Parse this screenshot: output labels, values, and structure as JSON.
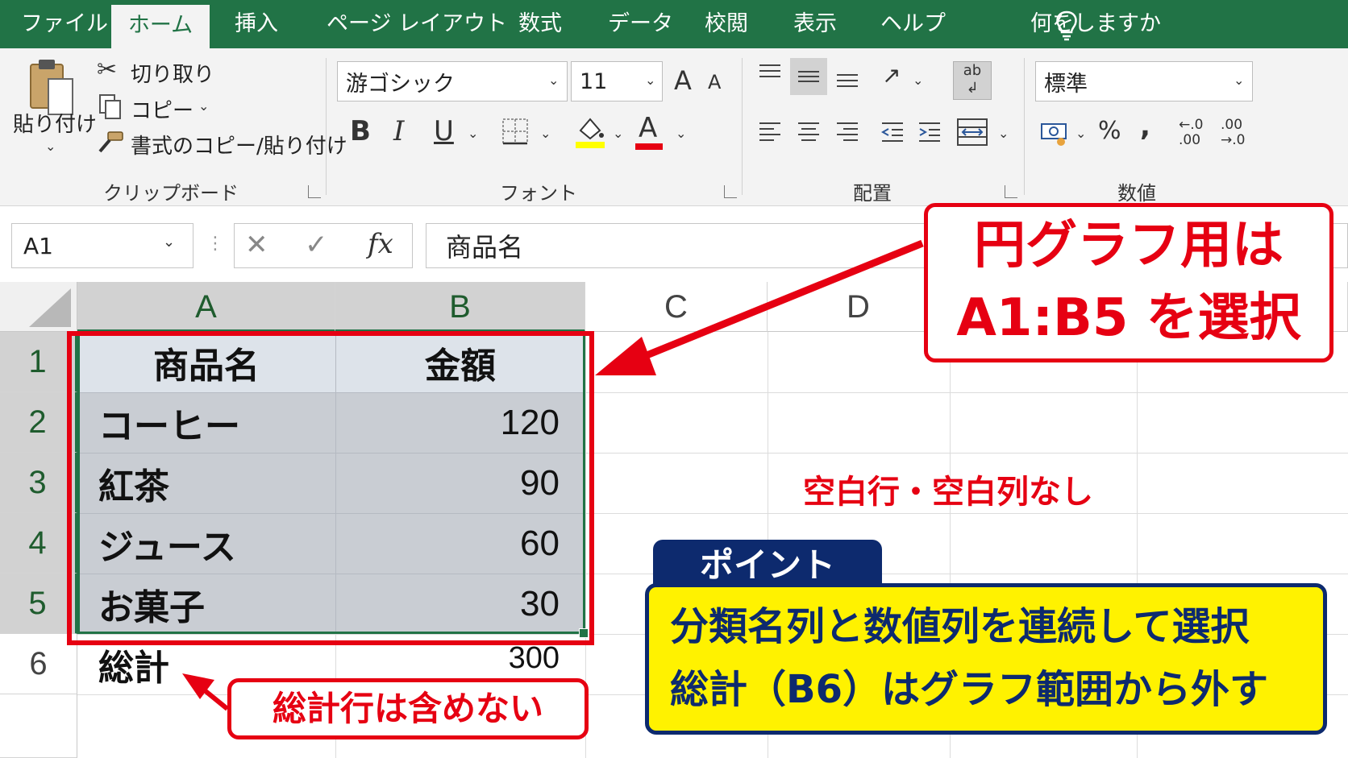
{
  "menu": {
    "tabs": [
      "ファイル",
      "ホーム",
      "挿入",
      "ページ レイアウト",
      "数式",
      "データ",
      "校閲",
      "表示",
      "ヘルプ"
    ],
    "active_tab": "ホーム",
    "tell_me": "何をしますか"
  },
  "ribbon": {
    "clipboard": {
      "paste_label": "貼り付け",
      "cut_label": "切り取り",
      "copy_label": "コピー",
      "format_painter_label": "書式のコピー/貼り付け",
      "group_label": "クリップボード"
    },
    "font": {
      "font_name": "游ゴシック",
      "font_size": "11",
      "bold": "B",
      "italic": "I",
      "underline": "U",
      "font_color_glyph": "A",
      "grow_glyph": "A",
      "shrink_glyph": "A",
      "group_label": "フォント"
    },
    "alignment": {
      "group_label": "配置",
      "wrap_glyph": "ab"
    },
    "number": {
      "format": "標準",
      "percent": "%",
      "comma": ",",
      "group_label": "数値",
      "inc_decimal_top": "←.0",
      "inc_decimal_bottom": ".00",
      "dec_decimal_top": ".00",
      "dec_decimal_bottom": "→.0"
    }
  },
  "formula_bar": {
    "name_box": "A1",
    "cancel": "✕",
    "enter": "✓",
    "fx": "fx",
    "content": "商品名"
  },
  "sheet": {
    "columns": [
      "A",
      "B",
      "C",
      "D"
    ],
    "rows": [
      "1",
      "2",
      "3",
      "4",
      "5",
      "6"
    ],
    "header_row": [
      "商品名",
      "金額"
    ],
    "data_rows": [
      {
        "name": "コーヒー",
        "amount": "120"
      },
      {
        "name": "紅茶",
        "amount": "90"
      },
      {
        "name": "ジュース",
        "amount": "60"
      },
      {
        "name": "お菓子",
        "amount": "30"
      }
    ],
    "total_row": {
      "name": "総計",
      "amount": "300"
    }
  },
  "annotations": {
    "callout_line1": "円グラフ用は",
    "callout_line2": "A1:B5 を選択",
    "no_blank": "空白行・空白列なし",
    "total_note": "総計行は含めない",
    "point_tag": "ポイント",
    "point_line1": "分類名列と数値列を連続して選択",
    "point_line2": "総計（B6）はグラフ範囲から外す"
  },
  "colors": {
    "excel_green": "#217346",
    "selection_fill": "#c9cdd3",
    "header_fill": "#dde3ea",
    "annotation_red": "#e60012",
    "point_navy": "#0d2a6e",
    "point_yellow": "#fff200"
  }
}
